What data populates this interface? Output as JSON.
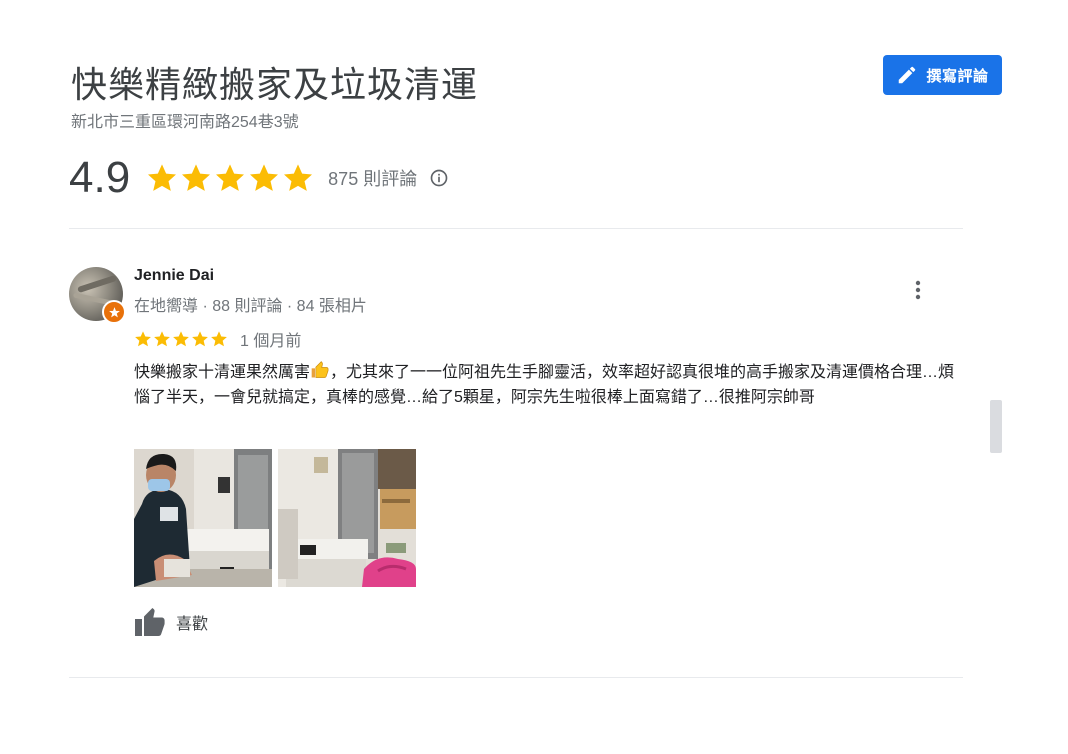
{
  "place": {
    "title": "快樂精緻搬家及垃圾清運",
    "address": "新北市三重區環河南路254巷3號"
  },
  "write_review_button": {
    "label": "撰寫評論",
    "icon": "pencil-icon"
  },
  "summary": {
    "rating": "4.9",
    "stars": 5,
    "review_count_text": "875 則評論",
    "info_icon": "info-icon"
  },
  "review": {
    "reviewer_name": "Jennie Dai",
    "reviewer_meta": "在地嚮導 · 88 則評論 · 84 張相片",
    "stars": 5,
    "time": "1 個月前",
    "text_before_emoji": "快樂搬家十清運果然厲害",
    "text_after_emoji": "，尤其來了一一位阿祖先生手腳靈活，效率超好認真很堆的高手搬家及清運價格合理…煩惱了半天，一會兒就搞定，真棒的感覺…給了5顆星，阿宗先生啦很棒上面寫錯了…很推阿宗帥哥",
    "photo_count": 2,
    "like_label": "喜歡"
  },
  "colors": {
    "accent": "#1a73e8",
    "star": "#fbbc04",
    "badge": "#e8710a"
  }
}
